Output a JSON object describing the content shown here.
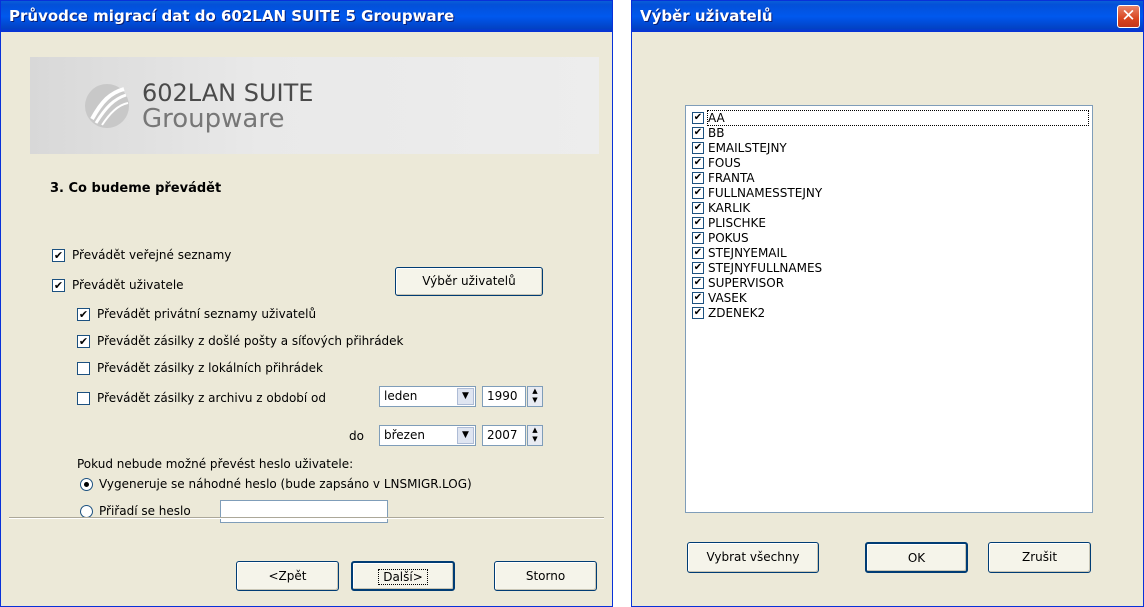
{
  "wizard": {
    "title": "Průvodce migrací dat do 602LAN SUITE 5 Groupware",
    "logo_line1": "602LAN SUITE",
    "logo_line2": "Groupware",
    "step_heading": "3. Co budeme převádět",
    "options": {
      "public_lists": {
        "label": "Převádět veřejné seznamy",
        "checked": true
      },
      "users": {
        "label": "Převádět uživatele",
        "checked": true
      },
      "private_lists": {
        "label": "Převádět privátní seznamy uživatelů",
        "checked": true
      },
      "received_mail": {
        "label": "Převádět zásilky z došlé pošty a síťových přihrádek",
        "checked": true
      },
      "local_folders": {
        "label": "Převádět zásilky z lokálních přihrádek",
        "checked": false
      },
      "archive": {
        "label": "Převádět zásilky z archivu z období od",
        "checked": false
      }
    },
    "select_users_button": "Výběr uživatelů",
    "from_month": "leden",
    "from_year": "1990",
    "to_label": "do",
    "to_month": "březen",
    "to_year": "2007",
    "password_prompt": "Pokud nebude možné převést heslo uživatele:",
    "radio_random": "Vygeneruje se náhodné heslo (bude zapsáno v LNSMIGR.LOG)",
    "radio_assign": "Přiřadí se heslo",
    "assign_password_value": "",
    "buttons": {
      "back": "<Zpět",
      "next": "Další>",
      "cancel": "Storno"
    }
  },
  "user_dialog": {
    "title": "Výběr uživatelů",
    "users": [
      "AA",
      "BB",
      "EMAILSTEJNY",
      "FOUS",
      "FRANTA",
      "FULLNAMESSTEJNY",
      "KARLIK",
      "PLISCHKE",
      "POKUS",
      "STEJNYEMAIL",
      "STEJNYFULLNAMES",
      "SUPERVISOR",
      "VASEK",
      "ZDENEK2"
    ],
    "buttons": {
      "select_all": "Vybrat všechny",
      "ok": "OK",
      "cancel": "Zrušit"
    }
  },
  "colors": {
    "titlebar": "#0058ee",
    "window_bg": "#ece9d8",
    "close": "#d9461f"
  }
}
